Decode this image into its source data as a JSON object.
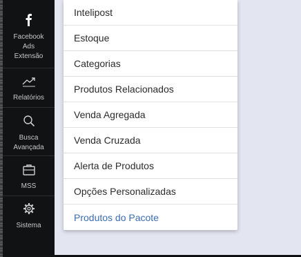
{
  "sidebar": {
    "items": [
      {
        "label": "Facebook\nAds\nExtensão",
        "icon": "facebook-icon"
      },
      {
        "label": "Relatórios",
        "icon": "trending-up-icon"
      },
      {
        "label": "Busca\nAvançada",
        "icon": "search-icon"
      },
      {
        "label": "MSS",
        "icon": "briefcase-icon"
      },
      {
        "label": "Sistema",
        "icon": "gear-icon"
      }
    ]
  },
  "menu": {
    "items": [
      {
        "label": "Intelipost"
      },
      {
        "label": "Estoque"
      },
      {
        "label": "Categorias"
      },
      {
        "label": "Produtos Relacionados"
      },
      {
        "label": "Venda Agregada"
      },
      {
        "label": "Venda Cruzada"
      },
      {
        "label": "Alerta de Produtos"
      },
      {
        "label": "Opções Personalizadas"
      },
      {
        "label": "Produtos do Pacote"
      }
    ],
    "active_color": "#3a6db3"
  },
  "colors": {
    "sidebar_bg": "#101213",
    "content_bg": "#e3e5f1",
    "menu_bg": "#ffffff"
  }
}
